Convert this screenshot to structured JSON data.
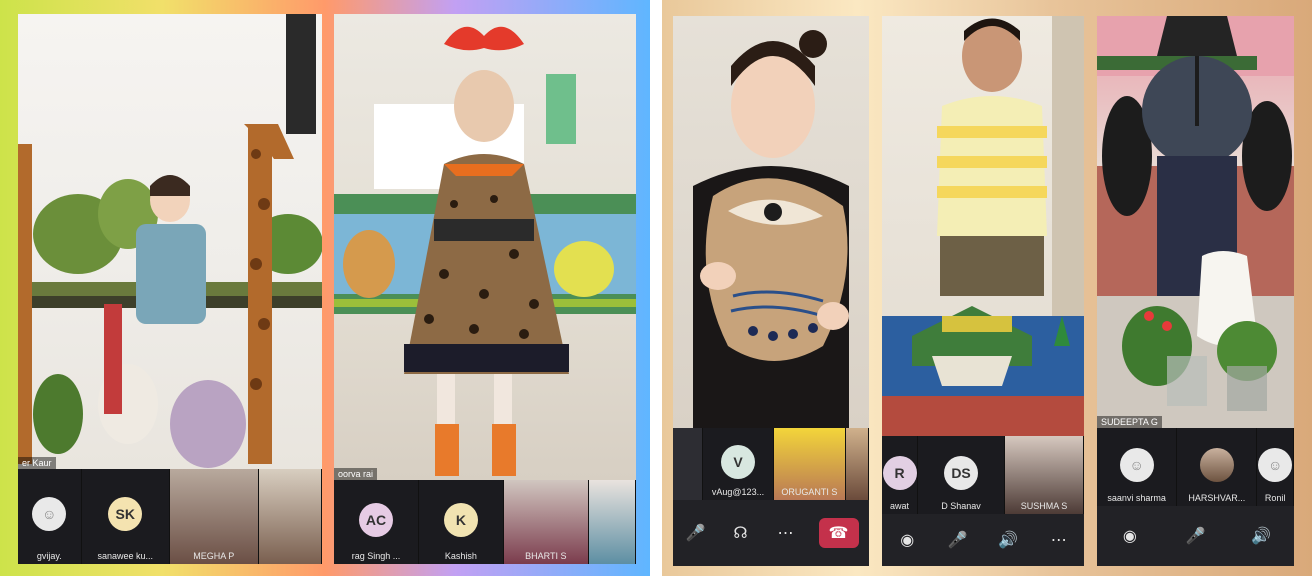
{
  "panels": {
    "p1": {
      "main_name": "er Kaur",
      "participants": [
        {
          "initials": "",
          "label": "gvijay.",
          "type": "person-icon"
        },
        {
          "initials": "SK",
          "label": "sanawee ku...",
          "type": "avatar",
          "color": "#f4e3b0"
        },
        {
          "initials": "",
          "label": "MEGHA P",
          "type": "video"
        },
        {
          "initials": "",
          "label": "",
          "type": "video"
        }
      ]
    },
    "p2": {
      "main_name": "oorva rai",
      "participants": [
        {
          "initials": "AC",
          "label": "rag Singh ...",
          "type": "avatar",
          "color": "#e6cbe4"
        },
        {
          "initials": "K",
          "label": "Kashish",
          "type": "avatar",
          "color": "#f1e3b1"
        },
        {
          "initials": "",
          "label": "BHARTI S",
          "type": "video"
        },
        {
          "initials": "",
          "label": "",
          "type": "video"
        }
      ]
    },
    "p3": {
      "participants": [
        {
          "initials": "",
          "label": "",
          "type": "video"
        },
        {
          "initials": "V",
          "label": "vAug@123...",
          "type": "avatar",
          "color": "#d8e7e0"
        },
        {
          "initials": "",
          "label": "ORUGANTI S",
          "type": "video"
        },
        {
          "initials": "",
          "label": "",
          "type": "video"
        }
      ]
    },
    "p4": {
      "participants": [
        {
          "initials": "R",
          "label": "awat",
          "type": "avatar",
          "color": "#e2cfe3"
        },
        {
          "initials": "DS",
          "label": "D Shanav",
          "type": "avatar",
          "color": "#e8e8e8"
        },
        {
          "initials": "",
          "label": "SUSHMA S",
          "type": "video"
        }
      ]
    },
    "p5": {
      "main_name": "SUDEEPTA G",
      "participants": [
        {
          "initials": "",
          "label": "saanvi sharma",
          "type": "person-icon"
        },
        {
          "initials": "",
          "label": "HARSHVAR...",
          "type": "video"
        },
        {
          "initials": "",
          "label": "Ronil",
          "type": "person-icon"
        }
      ]
    }
  },
  "colors": {
    "teams_end_call": "#c4314b",
    "strip_bg": "#1b1b1f"
  }
}
